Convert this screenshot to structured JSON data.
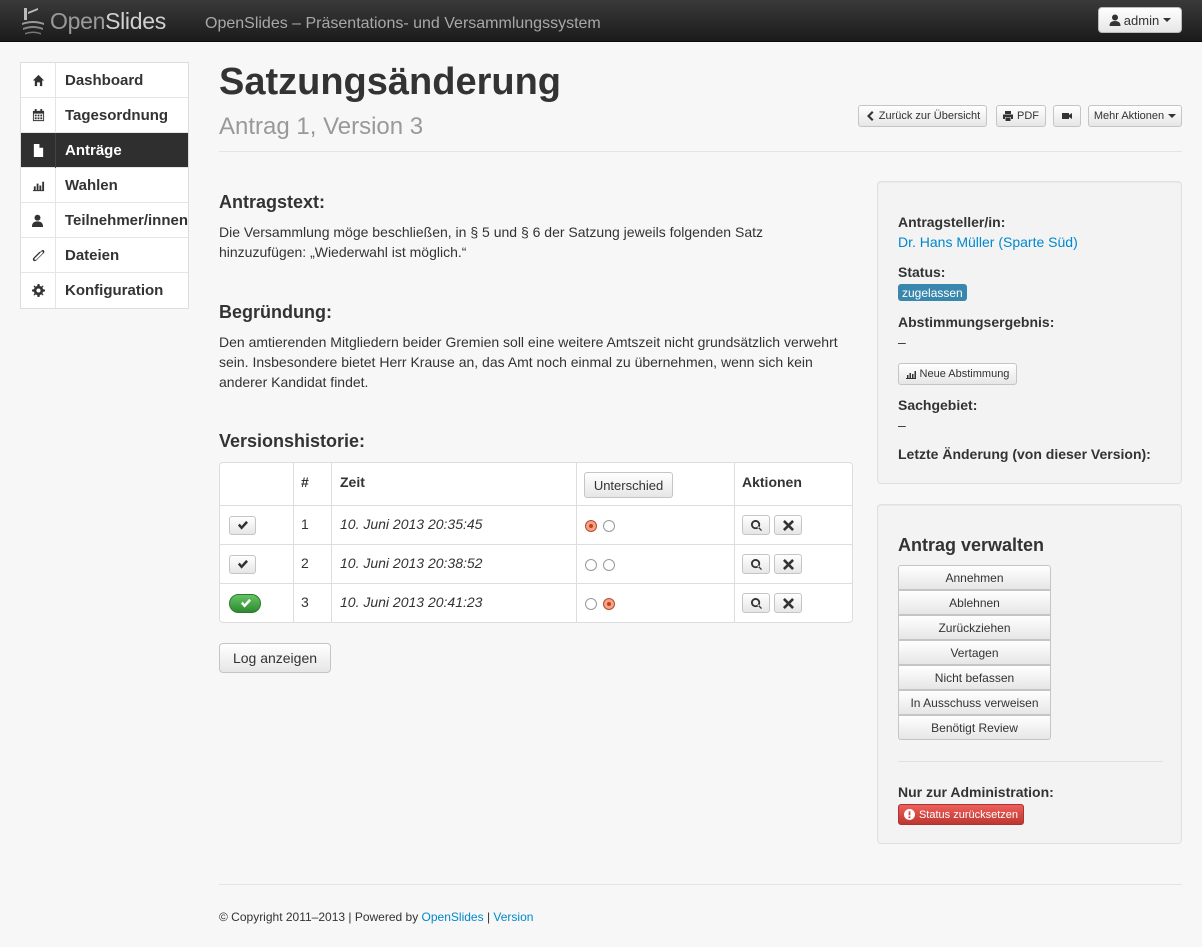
{
  "navbar": {
    "brand_light": "Open",
    "brand_bold": "Slides",
    "tagline": "OpenSlides – Präsentations- und Versammlungssystem",
    "user_label": "admin"
  },
  "sidebar": {
    "items": [
      {
        "label": "Dashboard",
        "icon": "home-icon"
      },
      {
        "label": "Tagesordnung",
        "icon": "calendar-icon"
      },
      {
        "label": "Anträge",
        "icon": "file-icon",
        "active": true
      },
      {
        "label": "Wahlen",
        "icon": "bar-chart-icon"
      },
      {
        "label": "Teilnehmer/innen",
        "icon": "user-icon"
      },
      {
        "label": "Dateien",
        "icon": "paperclip-icon"
      },
      {
        "label": "Konfiguration",
        "icon": "cog-icon"
      }
    ]
  },
  "header": {
    "title": "Satzungsänderung",
    "subtitle": "Antrag 1, Version 3",
    "back_label": "Zurück zur Übersicht",
    "pdf_label": "PDF",
    "more_label": "Mehr Aktionen"
  },
  "main": {
    "motion_text_heading": "Antragstext:",
    "motion_text": "Die Versammlung möge beschließen, in § 5 und § 6 der Satzung jeweils folgenden Satz hinzuzufügen: „Wiederwahl ist möglich.“",
    "reason_heading": "Begründung:",
    "reason_text": "Den amtierenden Mitgliedern beider Gremien soll eine weitere Amtszeit nicht grundsätzlich verwehrt sein. Insbesondere bietet Herr Krause an, das Amt noch einmal zu übernehmen, wenn sich kein anderer Kandidat findet.",
    "history_heading": "Versionshistorie:",
    "history": {
      "columns": {
        "number": "#",
        "time": "Zeit",
        "diff_button": "Unterschied",
        "actions": "Aktionen"
      },
      "rows": [
        {
          "number": "1",
          "time": "10. Juni 2013 20:35:45",
          "current": false,
          "radio_left": true,
          "radio_right": false
        },
        {
          "number": "2",
          "time": "10. Juni 2013 20:38:52",
          "current": false,
          "radio_left": false,
          "radio_right": false
        },
        {
          "number": "3",
          "time": "10. Juni 2013 20:41:23",
          "current": true,
          "radio_left": false,
          "radio_right": true
        }
      ]
    },
    "log_button": "Log anzeigen"
  },
  "details": {
    "submitter_label": "Antragsteller/in:",
    "submitter": "Dr. Hans Müller (Sparte Süd)",
    "status_label": "Status:",
    "status": "zugelassen",
    "vote_label": "Abstimmungsergebnis:",
    "vote_value": "–",
    "new_vote_button": "Neue Abstimmung",
    "category_label": "Sachgebiet:",
    "category_value": "–",
    "last_change_label": "Letzte Änderung (von dieser Version):"
  },
  "manage": {
    "title": "Antrag verwalten",
    "actions": [
      "Annehmen",
      "Ablehnen",
      "Zurückziehen",
      "Vertagen",
      "Nicht befassen",
      "In Ausschuss verweisen",
      "Benötigt Review"
    ],
    "admin_label": "Nur zur Administration:",
    "reset_button": "Status zurücksetzen"
  },
  "footer": {
    "copyright": "© Copyright 2011–2013 | Powered by",
    "link_openslides": "OpenSlides",
    "separator": "|",
    "link_version": "Version"
  },
  "colors": {
    "navbar": "#222222",
    "link": "#0088cc",
    "status_badge": "#3a87ad",
    "success": "#51a351",
    "danger": "#bd362f",
    "sidebar_active": "#2f2f2f"
  }
}
